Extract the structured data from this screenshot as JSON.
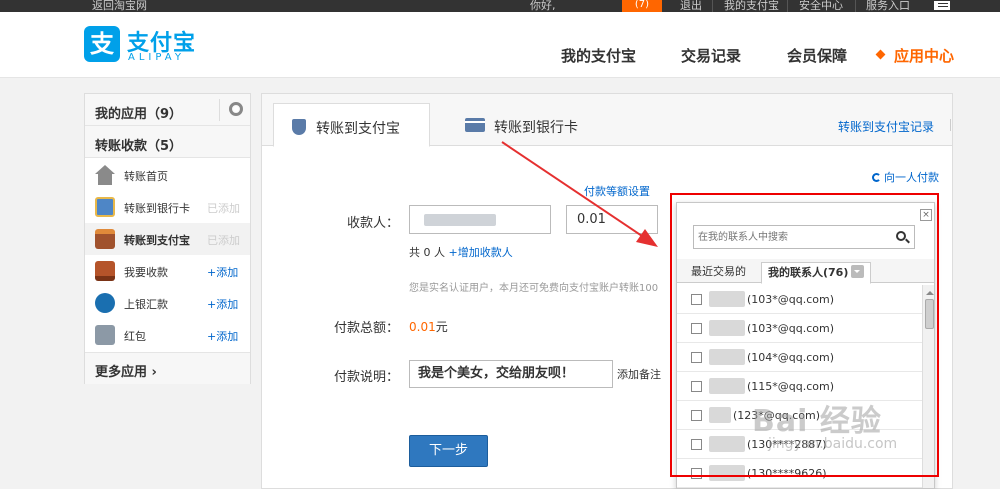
{
  "topbar": {
    "back_link": "返回淘宝网",
    "greeting": "你好,",
    "msg_badge": "(7)",
    "logout": "退出",
    "my_alipay": "我的支付宝",
    "security": "安全中心",
    "service": "服务入口"
  },
  "header": {
    "logo_cn": "支付宝",
    "logo_en": "ALIPAY",
    "logo_glyph": "支",
    "nav": [
      "我的支付宝",
      "交易记录",
      "会员保障",
      "应用中心"
    ],
    "active_nav_color": "#ff6600"
  },
  "sidebar": {
    "my_apps": "我的应用（9）",
    "transfer_title": "转账收款（5）",
    "items": [
      {
        "label": "转账首页",
        "status": "",
        "icon": "home-icon"
      },
      {
        "label": "转账到银行卡",
        "status": "已添加",
        "icon": "bank-card-icon"
      },
      {
        "label": "转账到支付宝",
        "status": "已添加",
        "icon": "alipay-transfer-icon"
      },
      {
        "label": "我要收款",
        "status": "+添加",
        "icon": "collect-icon"
      },
      {
        "label": "上银汇款",
        "status": "+添加",
        "icon": "bank-remit-icon"
      },
      {
        "label": "红包",
        "status": "+添加",
        "icon": "puzzle-icon"
      }
    ],
    "more_apps": "更多应用"
  },
  "main": {
    "tabs": [
      "转账到支付宝",
      "转账到银行卡"
    ],
    "records_link": "转账到支付宝记录",
    "one_pay": "向一人付款",
    "amount_setting": "付款等额设置",
    "payee_label": "收款人：",
    "amount_value": "0.01",
    "count_text": "共 0 人",
    "add_payee": "+增加收款人",
    "hint": "您是实名认证用户，本月还可免费向支付宝账户转账100",
    "total_label": "付款总额：",
    "total_value": "0.01",
    "total_unit": "元",
    "note_label": "付款说明：",
    "note_value": "我是个美女，交给朋友呗！",
    "add_note": "添加备注",
    "next_button": "下一步"
  },
  "popup": {
    "search_placeholder": "在我的联系人中搜索",
    "tabs": [
      "最近交易的",
      "我的联系人(76)"
    ],
    "close": "×",
    "contacts": [
      {
        "email": "(103*@qq.com)"
      },
      {
        "email": "(103*@qq.com)"
      },
      {
        "email": "(104*@qq.com)"
      },
      {
        "email": "(115*@qq.com)"
      },
      {
        "email": "(123*@qq.com)"
      },
      {
        "email": "(130****2887)"
      },
      {
        "email": "(130****9626)"
      }
    ]
  },
  "watermark": {
    "text": "Bai 经验",
    "sub": "jingyan.baidu.com"
  }
}
